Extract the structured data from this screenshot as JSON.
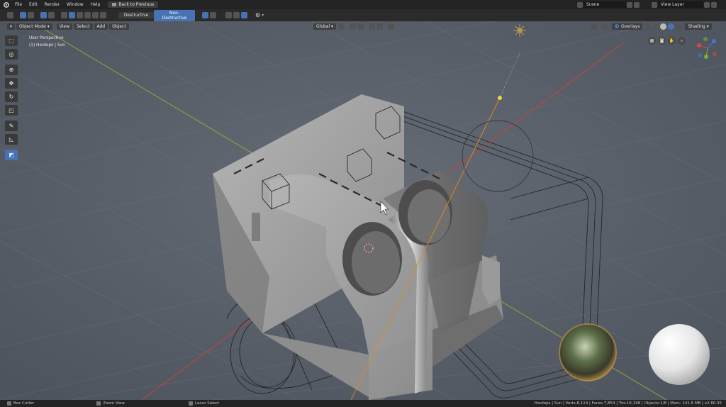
{
  "topbar": {
    "menu": [
      "File",
      "Edit",
      "Render",
      "Window",
      "Help"
    ],
    "back_button": "Back to Previous",
    "scene_label": "Scene",
    "view_layer_label": "View Layer"
  },
  "hardops_header": {
    "destructive": "Destructive",
    "non_destructive": "Non-Destructive"
  },
  "viewport_header": {
    "mode": "Object Mode",
    "menus": [
      "View",
      "Select",
      "Add",
      "Object"
    ],
    "transform_orientation": "Global",
    "overlays": "Overlays",
    "shading": "Shading"
  },
  "viewport_info": {
    "view_name": "User Perspective",
    "object_info": "(1) Hardops | Sun"
  },
  "toolbar": {
    "tools": [
      "select-box",
      "cursor",
      "move-all",
      "move",
      "rotate",
      "scale",
      "annotate",
      "measure",
      "box-cutter"
    ],
    "active_tool": "box-cutter"
  },
  "statusbar": {
    "left_action": "Box Cutter",
    "middle_action": "Zoom View",
    "right_action": "Lasso Select",
    "stats": "Hardops | Sun | Verts:8,114 | Faces:7,854 | Tris:16,198 | Objects:1/8 | Mem: 141.6 MB | v2.80.35"
  },
  "colors": {
    "accent": "#4772b3",
    "viewport_bg": "#5b616b",
    "grid_x_axis": "#c8413f",
    "grid_y_axis": "#8fa33a",
    "light_line": "#e08a20"
  }
}
